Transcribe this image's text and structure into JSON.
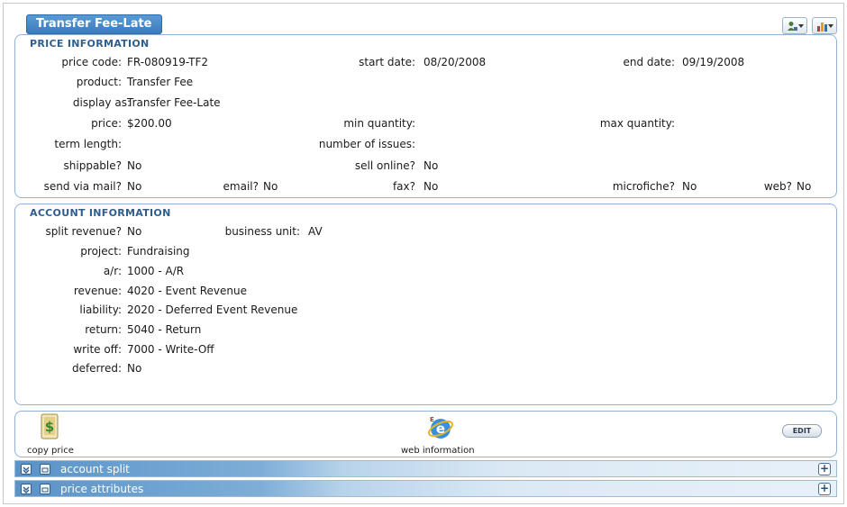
{
  "title": "Transfer Fee-Late",
  "price_info": {
    "heading": "PRICE INFORMATION",
    "price_code_label": "price code:",
    "price_code": "FR-080919-TF2",
    "start_date_label": "start date:",
    "start_date": "08/20/2008",
    "end_date_label": "end date:",
    "end_date": "09/19/2008",
    "product_label": "product:",
    "product": "Transfer Fee",
    "display_as_label": "display as:",
    "display_as": "Transfer Fee-Late",
    "price_label": "price:",
    "price": "$200.00",
    "min_quantity_label": "min quantity:",
    "min_quantity": "",
    "max_quantity_label": "max quantity:",
    "max_quantity": "",
    "term_length_label": "term length:",
    "term_length": "",
    "number_of_issues_label": "number of issues:",
    "number_of_issues": "",
    "shippable_label": "shippable?",
    "shippable": "No",
    "sell_online_label": "sell online?",
    "sell_online": "No",
    "send_via_mail_label": "send via mail?",
    "send_via_mail": "No",
    "email_label": "email?",
    "email": "No",
    "fax_label": "fax?",
    "fax": "No",
    "microfiche_label": "microfiche?",
    "microfiche": "No",
    "web_label": "web?",
    "web": "No"
  },
  "account_info": {
    "heading": "ACCOUNT INFORMATION",
    "split_revenue_label": "split revenue?",
    "split_revenue": "No",
    "business_unit_label": "business unit:",
    "business_unit": "AV",
    "project_label": "project:",
    "project": "Fundraising",
    "ar_label": "a/r:",
    "ar": "1000 - A/R",
    "revenue_label": "revenue:",
    "revenue": "4020 - Event Revenue",
    "liability_label": "liability:",
    "liability": "2020 - Deferred Event Revenue",
    "return_label": "return:",
    "return": "5040 - Return",
    "write_off_label": "write off:",
    "write_off": "7000 - Write-Off",
    "deferred_label": "deferred:",
    "deferred": "No"
  },
  "actions": {
    "copy_price": "copy price",
    "web_information": "web information",
    "edit": "EDIT"
  },
  "bars": {
    "account_split": "account split",
    "price_attributes": "price attributes"
  },
  "icons": {
    "copy_price": "dollar-document-icon",
    "web_information": "internet-explorer-icon",
    "person_menu": "person-icon",
    "chart_menu": "chart-icon"
  }
}
